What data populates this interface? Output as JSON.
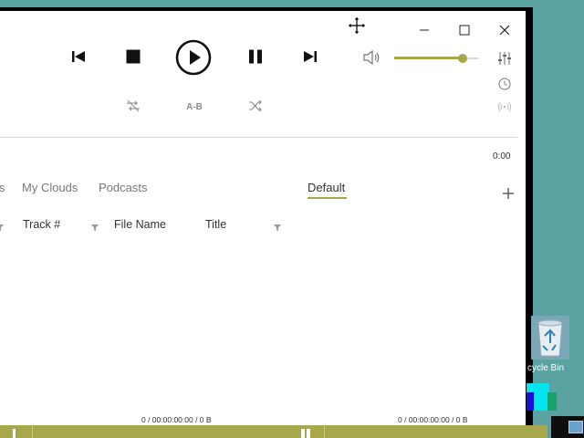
{
  "player": {
    "ab_label": "A-B",
    "time": "0:00",
    "volume_level": 0.82,
    "accent": "#a6a84c"
  },
  "tabs": [
    {
      "label": "s"
    },
    {
      "label": "My Clouds"
    },
    {
      "label": "Podcasts"
    },
    {
      "label": "Default",
      "active": true
    }
  ],
  "columns": [
    {
      "label": "Track #"
    },
    {
      "label": "File Name"
    },
    {
      "label": "Title"
    }
  ],
  "status": {
    "left": "0 / 00:00:00:00 / 0 B",
    "right": "0 / 00:00:00:00 / 0 B"
  },
  "desktop": {
    "recycle_label": "cycle Bin"
  }
}
